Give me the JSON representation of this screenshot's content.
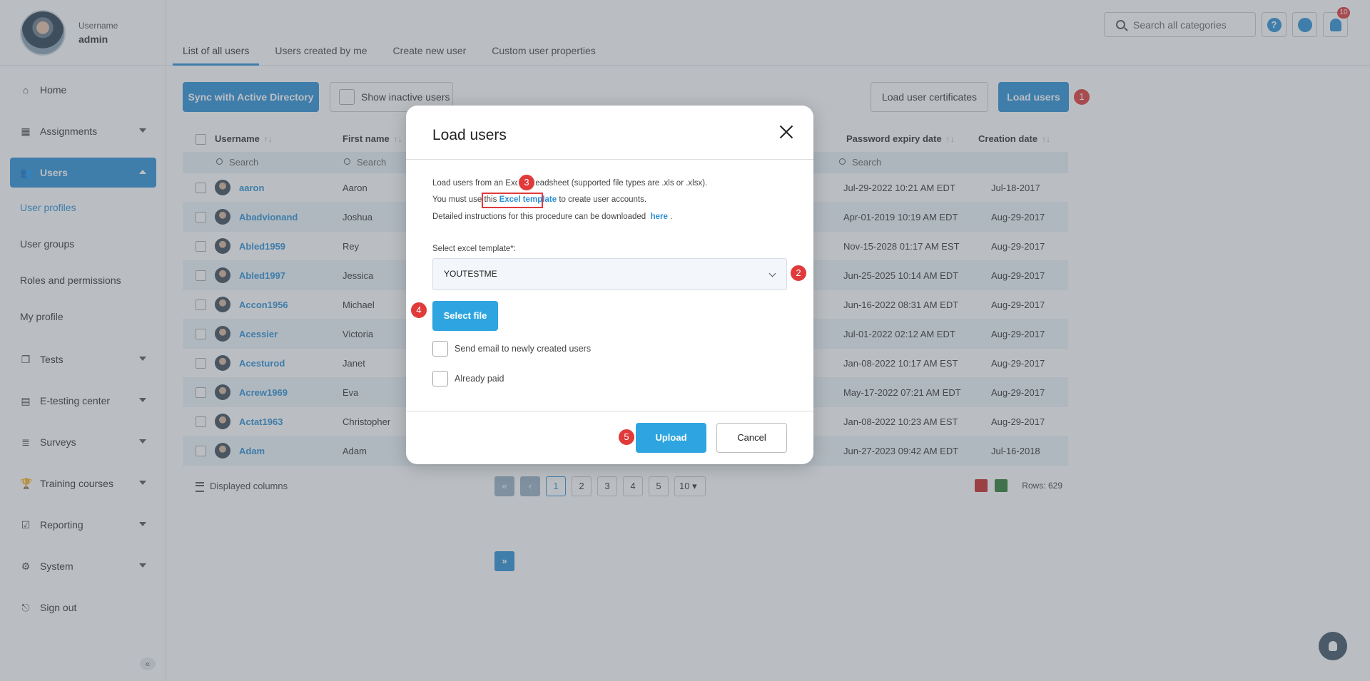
{
  "profile": {
    "label": "Username",
    "name": "admin"
  },
  "sidebar": {
    "items": [
      {
        "label": "Home",
        "icon": "home-icon",
        "glyph": "⌂"
      },
      {
        "label": "Assignments",
        "icon": "dashboard-icon",
        "glyph": "▦"
      },
      {
        "label": "Users",
        "icon": "users-icon",
        "glyph": "👥"
      },
      {
        "label": "Tests",
        "icon": "tests-icon",
        "glyph": "❐"
      },
      {
        "label": "E-testing center",
        "icon": "calendar-icon",
        "glyph": "▤"
      },
      {
        "label": "Surveys",
        "icon": "list-icon",
        "glyph": "≣"
      },
      {
        "label": "Training courses",
        "icon": "trophy-icon",
        "glyph": "🏆"
      },
      {
        "label": "Reporting",
        "icon": "report-icon",
        "glyph": "☑"
      },
      {
        "label": "System",
        "icon": "gear-icon",
        "glyph": "⚙"
      },
      {
        "label": "Sign out",
        "icon": "sign-out-icon",
        "glyph": "⎋"
      }
    ],
    "user_sub": [
      "User profiles",
      "User groups",
      "Roles and permissions",
      "My profile"
    ]
  },
  "topbar": {
    "search_placeholder": "Search all categories",
    "help_glyph": "?",
    "notifications": "10"
  },
  "tabs": [
    "List of all users",
    "Users created by me",
    "Create new user",
    "Custom user properties"
  ],
  "toolbar": {
    "sync": "Sync with Active Directory",
    "show_inactive": "Show inactive users",
    "load_certs": "Load user certificates",
    "load_users": "Load users"
  },
  "table": {
    "headers": {
      "username": "Username",
      "first_name": "First name",
      "password_expiry": "Password expiry date",
      "creation": "Creation date"
    },
    "sort_glyph": "↑↓",
    "filter_placeholder": "Search",
    "rows": [
      {
        "username": "aaron",
        "first": "Aaron",
        "pexp": "Jul-29-2022 10:21 AM EDT",
        "created": "Jul-18-2017"
      },
      {
        "username": "Abadvionand",
        "first": "Joshua",
        "pexp": "Apr-01-2019 10:19 AM EDT",
        "created": "Aug-29-2017"
      },
      {
        "username": "Abled1959",
        "first": "Rey",
        "pexp": "Nov-15-2028 01:17 AM EST",
        "created": "Aug-29-2017"
      },
      {
        "username": "Abled1997",
        "first": "Jessica",
        "pexp": "Jun-25-2025 10:14 AM EDT",
        "created": "Aug-29-2017"
      },
      {
        "username": "Accon1956",
        "first": "Michael",
        "pexp": "Jun-16-2022 08:31 AM EDT",
        "created": "Aug-29-2017"
      },
      {
        "username": "Acessier",
        "first": "Victoria",
        "pexp": "Jul-01-2022 02:12 AM EDT",
        "created": "Aug-29-2017"
      },
      {
        "username": "Acesturod",
        "first": "Janet",
        "pexp": "Jan-08-2022 10:17 AM EST",
        "created": "Aug-29-2017"
      },
      {
        "username": "Acrew1969",
        "first": "Eva",
        "pexp": "May-17-2022 07:21 AM EDT",
        "created": "Aug-29-2017"
      },
      {
        "username": "Actat1963",
        "first": "Christopher",
        "pexp": "Jan-08-2022 10:23 AM EST",
        "created": "Aug-29-2017"
      },
      {
        "username": "Adam",
        "first": "Adam",
        "pexp": "Jun-27-2023 09:42 AM EDT",
        "created": "Jul-16-2018"
      }
    ]
  },
  "footer": {
    "displayed_columns": "Displayed columns",
    "pages": [
      "1",
      "2",
      "3",
      "4",
      "5"
    ],
    "first_glyph": "«",
    "prev_glyph": "‹",
    "next_glyph": "›",
    "last_glyph": "»",
    "page_size": "10",
    "size_caret": "▾",
    "rows": "Rows: 629"
  },
  "modal": {
    "title": "Load users",
    "line1_a": "Load users from an Exc",
    "line1_b": "readsheet (supported file types are .xls or .xlsx).",
    "line2_a": "You must use this",
    "line2_link": "Excel template",
    "line2_b": "to create user accounts.",
    "line3_a": "Detailed instructions for this procedure can be downloaded",
    "line3_link": "here",
    "line3_b": ".",
    "select_label": "Select excel template*:",
    "select_value": "YOUTESTME",
    "select_file": "Select file",
    "send_email": "Send email to newly created users",
    "already_paid": "Already paid",
    "upload": "Upload",
    "cancel": "Cancel"
  },
  "badges": [
    "1",
    "2",
    "3",
    "4",
    "5"
  ],
  "colors": {
    "accent": "#2b8fd6",
    "badge": "#e03a3a"
  }
}
